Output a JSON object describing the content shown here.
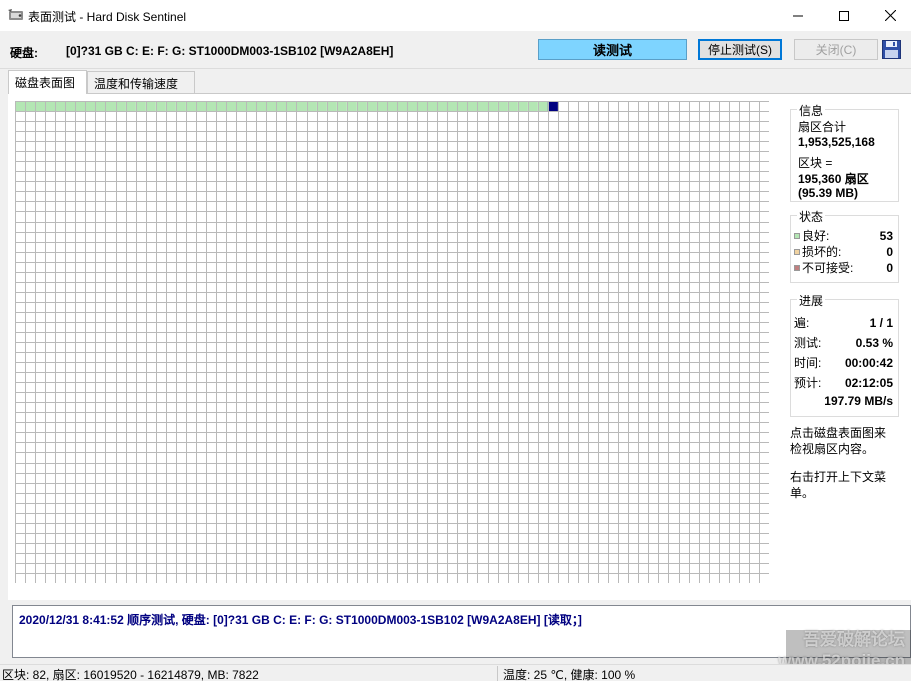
{
  "window": {
    "title": "表面测试 - Hard Disk Sentinel",
    "icon": "hdd-sentinel-icon"
  },
  "disk_row": {
    "label": "硬盘:",
    "value": "[0]?31 GB C: E: F: G: ST1000DM003-1SB102 [W9A2A8EH]",
    "mode": "读测试",
    "mode_color": "#7ed4ff",
    "stop_button": "停止测试(S)",
    "close_button": "关闭(C)"
  },
  "tabs": [
    {
      "label": "磁盘表面图",
      "active": true
    },
    {
      "label": "温度和传输速度",
      "active": false
    }
  ],
  "surface_map": {
    "columns": 75,
    "rows": 48,
    "tested_blocks": 53,
    "current_block": 54,
    "good_color": "#b4e6b4",
    "current_color": "#00007f",
    "untested_color": "#ffffff",
    "cell_border_color": "#b9b9b9"
  },
  "info": {
    "title": "信息",
    "sectors_label": "扇区合计",
    "sectors_value": "1,953,525,168",
    "block_label": "区块 =",
    "block_sectors": "195,360",
    "block_sectors_unit": "扇区",
    "block_size": "(95.39 MB)"
  },
  "status": {
    "title": "状态",
    "items": [
      {
        "label": "良好:",
        "value": "53",
        "color": "#b4e6b4"
      },
      {
        "label": "损坏的:",
        "value": "0",
        "color": "#f0d2a0"
      },
      {
        "label": "不可接受:",
        "value": "0",
        "color": "#c08080"
      }
    ]
  },
  "progress": {
    "title": "进展",
    "pass_label": "遍:",
    "pass_value": "1 / 1",
    "tested_label": "测试:",
    "tested_value": "0.53 %",
    "time_label": "时间:",
    "time_value": "00:00:42",
    "eta_label": "预计:",
    "eta_value": "02:12:05",
    "speed": "197.79 MB/s"
  },
  "notes": {
    "click_hint_1": "点击磁盘表面图来",
    "click_hint_2": "检视扇区内容。",
    "right_click_1": "右击打开上下文菜",
    "right_click_2": "单。"
  },
  "log": {
    "text": "2020/12/31  8:41:52   顺序测试, 硬盘:   [0]?31 GB C: E: F: G: ST1000DM003-1SB102 [W9A2A8EH] [读取；]"
  },
  "statusbar": {
    "block_info": "区块: 82, 扇区: 16019520 - 16214879, MB: 7822",
    "temperature": "温度: 25  ℃,  健康:  100 %"
  },
  "watermark": {
    "line1": "吾爱破解论坛",
    "line2": "www.52pojie.cn"
  }
}
